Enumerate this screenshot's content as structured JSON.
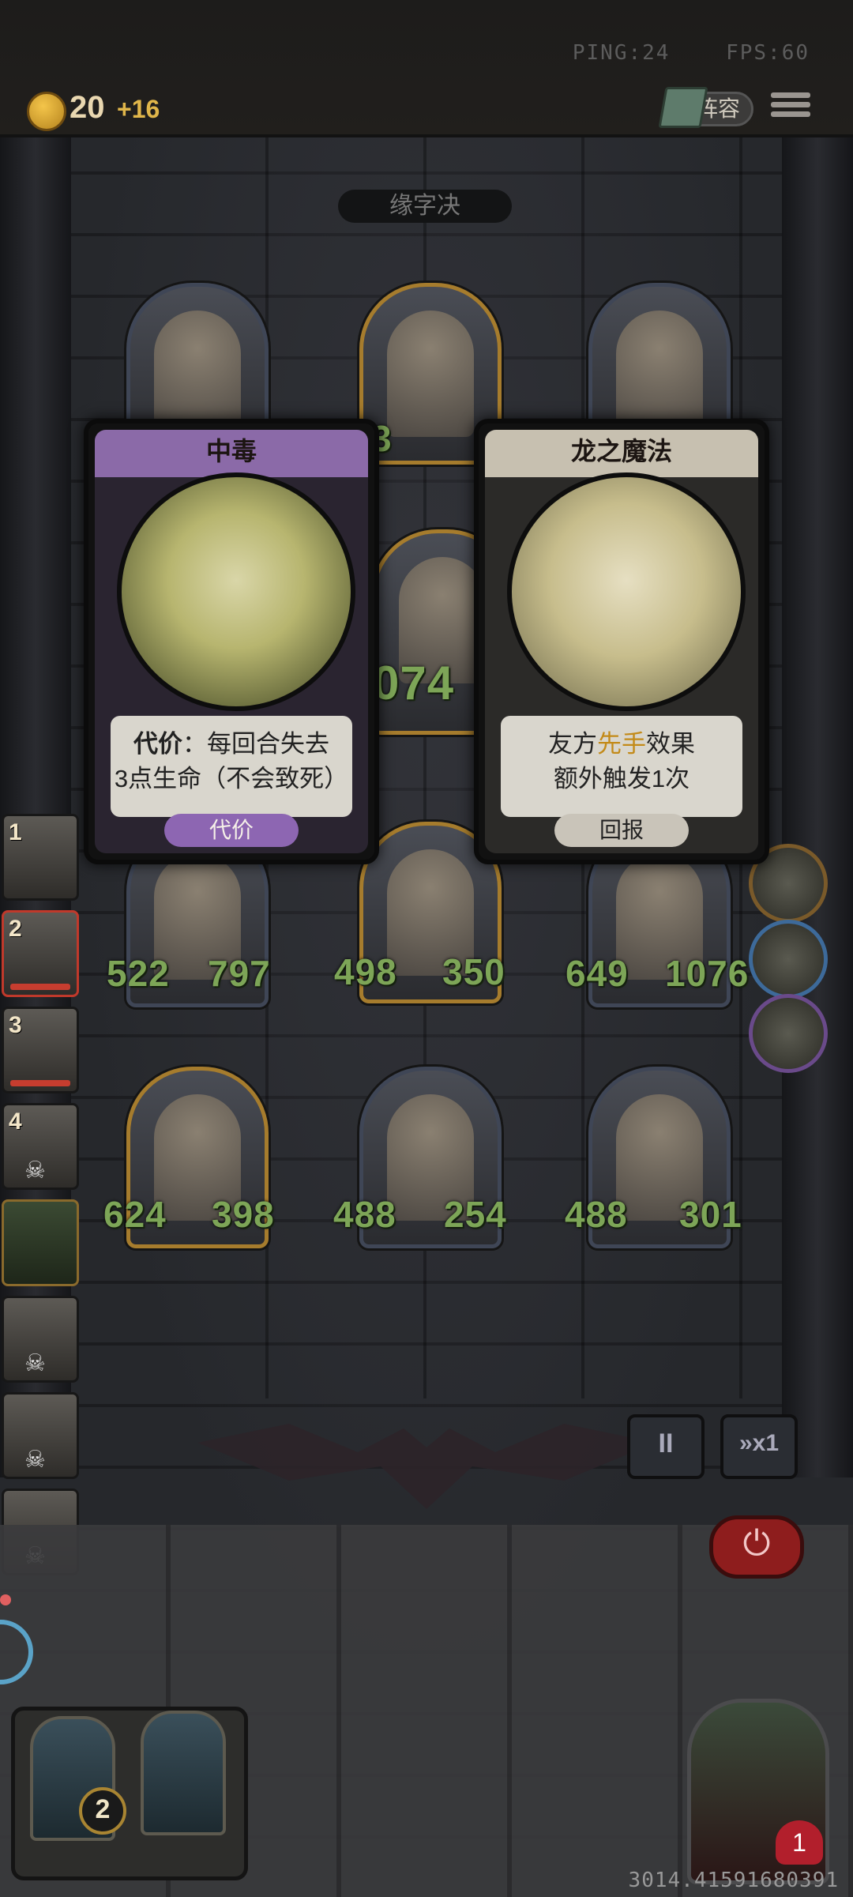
{
  "hud": {
    "ping": "PING:24",
    "fps": "FPS:60",
    "gold": "20",
    "gold_delta": "+16",
    "lineup_label": "阵容"
  },
  "banner": "缘字决",
  "cards": [
    {
      "title": "中毒",
      "desc_key": "代价",
      "desc_line1": "：每回合失去",
      "desc_line2": "3点生命（不会致死）",
      "tag": "代价"
    },
    {
      "title": "龙之魔法",
      "desc_line1_pre": "友方",
      "desc_line1_hl": "先手",
      "desc_line1_post": "效果",
      "desc_line2": "额外触发1次",
      "tag": "回报"
    }
  ],
  "board": {
    "hidden_middle_stat": "3",
    "middle_big_number": "074",
    "row2": [
      {
        "atk": "522",
        "hp": "797"
      },
      {
        "atk": "498",
        "hp": "350"
      },
      {
        "atk": "649",
        "hp": "1076"
      }
    ],
    "row3": [
      {
        "atk": "624",
        "hp": "398"
      },
      {
        "atk": "488",
        "hp": "254"
      },
      {
        "atk": "488",
        "hp": "301"
      }
    ]
  },
  "side_slots": [
    {
      "num": "1"
    },
    {
      "num": "2"
    },
    {
      "num": "3"
    },
    {
      "num": "4"
    }
  ],
  "controls": {
    "pause": "II",
    "speed": "»x1",
    "power": "⏻"
  },
  "bottom": {
    "tray_count": "2",
    "hero_hp": "1",
    "seq": "3014.41591680391"
  },
  "colors": {
    "stat_green": "#7da557",
    "card_purple": "#8b6aa8",
    "card_beige": "#c7c0b0",
    "highlight": "#c38a18",
    "danger_red": "#b21f2c"
  }
}
